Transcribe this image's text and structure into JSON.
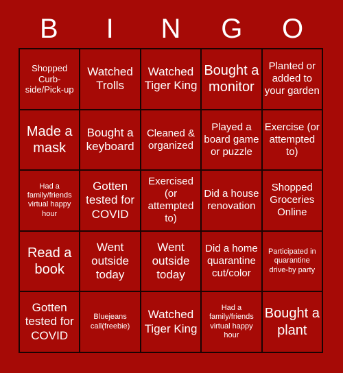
{
  "colors": {
    "background": "#a60a06",
    "cell_background": "#a60a06",
    "grid_line": "#1a0302",
    "text": "#ffffff"
  },
  "header": {
    "letters": [
      "B",
      "I",
      "N",
      "G",
      "O"
    ]
  },
  "grid": {
    "columns": 5,
    "rows": 5,
    "cells": [
      {
        "text": "Shopped Curb-side/Pick-up",
        "size": "s"
      },
      {
        "text": "Watched Trolls",
        "size": "l"
      },
      {
        "text": "Watched Tiger King",
        "size": "l"
      },
      {
        "text": "Bought a monitor",
        "size": "xl"
      },
      {
        "text": "Planted or added to your garden",
        "size": "m"
      },
      {
        "text": "Made a mask",
        "size": "xl"
      },
      {
        "text": "Bought a keyboard",
        "size": "l"
      },
      {
        "text": "Cleaned & organized",
        "size": "m"
      },
      {
        "text": "Played a board game or puzzle",
        "size": "m"
      },
      {
        "text": "Exercise (or attempted to)",
        "size": "m"
      },
      {
        "text": "Had a family/friends virtual happy hour",
        "size": "xs"
      },
      {
        "text": "Gotten tested for COVID",
        "size": "l"
      },
      {
        "text": "Exercised (or attempted to)",
        "size": "m"
      },
      {
        "text": "Did a house renovation",
        "size": "m"
      },
      {
        "text": "Shopped Groceries Online",
        "size": "m"
      },
      {
        "text": "Read a book",
        "size": "xl"
      },
      {
        "text": "Went outside today",
        "size": "l"
      },
      {
        "text": "Went outside today",
        "size": "l"
      },
      {
        "text": "Did a home quarantine cut/color",
        "size": "m"
      },
      {
        "text": "Participated in quarantine drive-by party",
        "size": "xs"
      },
      {
        "text": "Gotten tested for COVID",
        "size": "l"
      },
      {
        "text": "Bluejeans call(freebie)",
        "size": "xs"
      },
      {
        "text": "Watched Tiger King",
        "size": "l"
      },
      {
        "text": "Had a family/friends virtual happy hour",
        "size": "xs"
      },
      {
        "text": "Bought a plant",
        "size": "xl"
      }
    ]
  }
}
